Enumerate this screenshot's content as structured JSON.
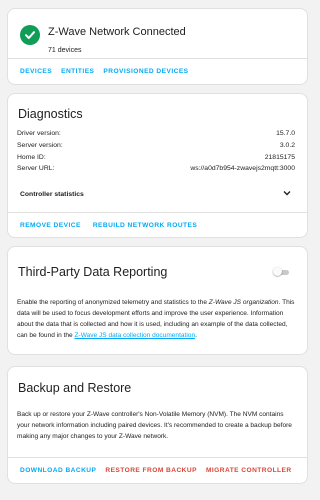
{
  "status_card": {
    "title": "Z-Wave Network Connected",
    "device_count": "71 devices",
    "actions": [
      "DEVICES",
      "ENTITIES",
      "PROVISIONED DEVICES"
    ]
  },
  "diagnostics": {
    "title": "Diagnostics",
    "rows": [
      {
        "label": "Driver version:",
        "value": "15.7.0"
      },
      {
        "label": "Server version:",
        "value": "3.0.2"
      },
      {
        "label": "Home ID:",
        "value": "21815175"
      },
      {
        "label": "Server URL:",
        "value": "ws://a0d7b954-zwavejs2mqtt:3000"
      }
    ],
    "expander_label": "Controller statistics",
    "actions": [
      "REMOVE DEVICE",
      "REBUILD NETWORK ROUTES"
    ]
  },
  "telemetry": {
    "title": "Third-Party Data Reporting",
    "toggle_on": false,
    "text_before": "Enable the reporting of anonymized telemetry and statistics to the ",
    "text_org": "Z-Wave JS organization",
    "text_after": ". This data will be used to focus development efforts and improve the user experience. Information about the data that is collected and how it is used, including an example of the data collected, can be found in the ",
    "link_text": "Z-Wave JS data collection documentation",
    "text_end": "."
  },
  "backup": {
    "title": "Backup and Restore",
    "description": "Back up or restore your Z-Wave controller's Non-Volatile Memory (NVM). The NVM contains your network information including paired devices. It's recommended to create a backup before making any major changes to your Z-Wave network.",
    "actions": [
      "DOWNLOAD BACKUP",
      "RESTORE FROM BACKUP",
      "MIGRATE CONTROLLER"
    ]
  },
  "colors": {
    "accent": "#03a9f4",
    "danger": "#db4437",
    "success": "#0f9d58"
  },
  "icons": [
    "check-circle-icon",
    "chevron-down-icon"
  ]
}
